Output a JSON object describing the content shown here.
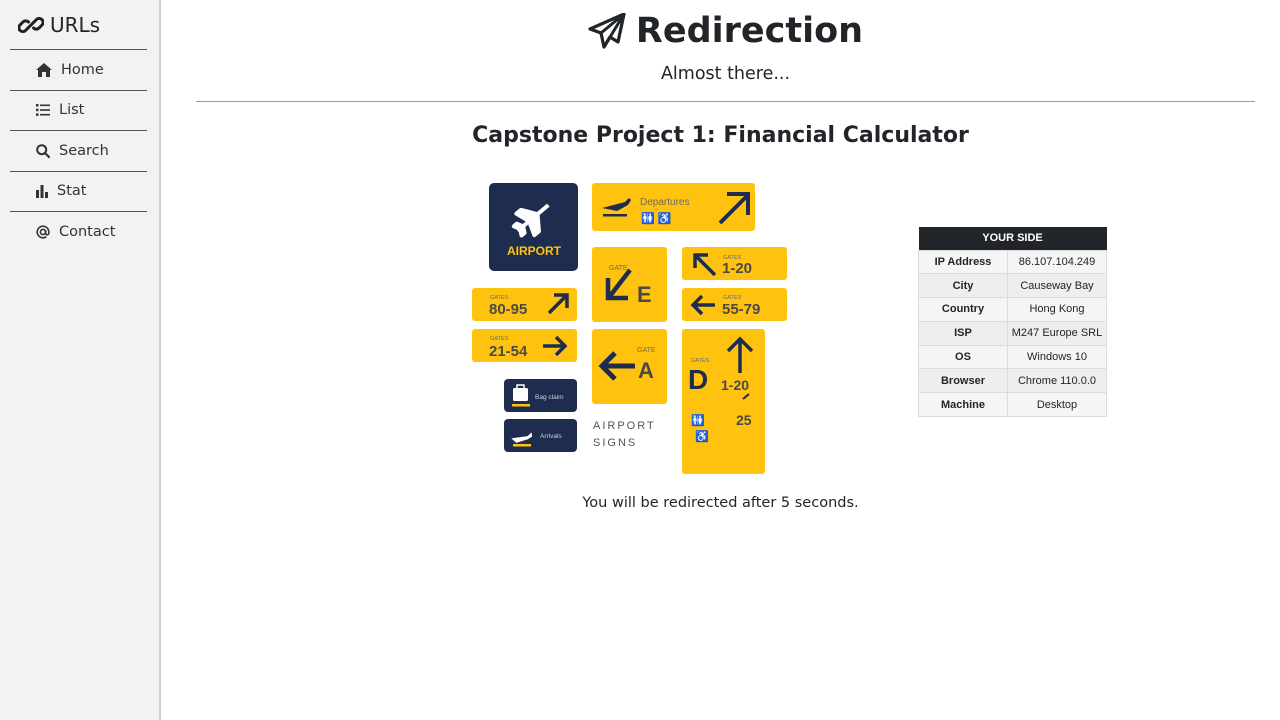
{
  "sidebar": {
    "brand": "URLs",
    "items": [
      {
        "label": "Home",
        "icon": "home-icon"
      },
      {
        "label": "List",
        "icon": "list-icon"
      },
      {
        "label": "Search",
        "icon": "search-icon"
      },
      {
        "label": "Stat",
        "icon": "bar-chart-icon"
      },
      {
        "label": "Contact",
        "icon": "at-icon"
      }
    ]
  },
  "header": {
    "title": "Redirection",
    "subtitle": "Almost there..."
  },
  "main": {
    "project_title": "Capstone Project 1: Financial Calculator",
    "redirect_message": "You will be redirected after 5 seconds."
  },
  "hero": {
    "airport": "AIRPORT",
    "departures": "Departures",
    "gates_small": "GATES",
    "gate_small": "GATE",
    "gates_1_20": "1-20",
    "gates_80_95": "80-95",
    "gates_55_79": "55-79",
    "gates_21_54": "21-54",
    "gate_e": "E",
    "gate_a": "A",
    "gate_d": "D",
    "d_range": "1-20",
    "d_25": "25",
    "bag_claim": "Bag claim",
    "arrivals": "Arrivals",
    "signs_line1": "AIRPORT",
    "signs_line2": "SIGNS",
    "colors": {
      "yellow": "#FFC20E",
      "navy": "#1E2D4F",
      "sign_text": "#4a4a4a"
    }
  },
  "info": {
    "heading": "YOUR SIDE",
    "rows": [
      {
        "key": "IP Address",
        "value": "86.107.104.249"
      },
      {
        "key": "City",
        "value": "Causeway Bay"
      },
      {
        "key": "Country",
        "value": "Hong Kong"
      },
      {
        "key": "ISP",
        "value": "M247 Europe SRL"
      },
      {
        "key": "OS",
        "value": "Windows 10"
      },
      {
        "key": "Browser",
        "value": "Chrome 110.0.0"
      },
      {
        "key": "Machine",
        "value": "Desktop"
      }
    ]
  }
}
